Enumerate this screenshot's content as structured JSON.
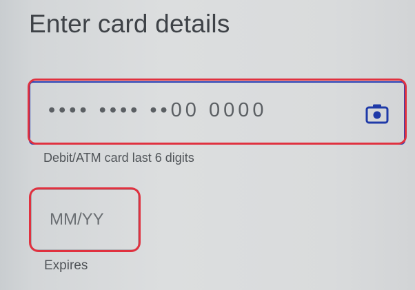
{
  "page": {
    "title": "Enter card details"
  },
  "card_number": {
    "value": "•••• •••• ••00 0000",
    "helper": "Debit/ATM card last 6 digits",
    "scan_icon": "camera-icon"
  },
  "expiry": {
    "placeholder": "MM/YY",
    "label": "Expires"
  },
  "colors": {
    "accent": "#2b3fb3",
    "highlight": "#e0313f",
    "text": "#3e4247"
  }
}
